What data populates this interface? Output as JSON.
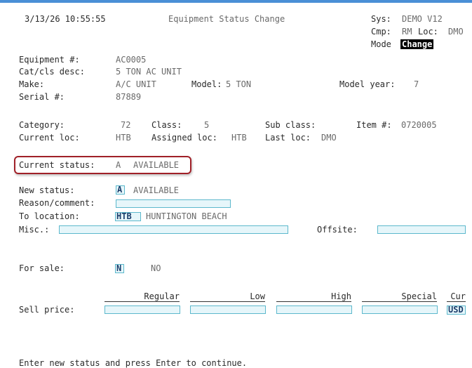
{
  "header": {
    "datetime": "3/13/26 10:55:55",
    "title": "Equipment Status Change",
    "sys_label": "Sys:",
    "sys_value": "DEMO V12",
    "cmp_label": "Cmp:",
    "cmp_value": "RM",
    "loc_label": "Loc:",
    "loc_value": "DMO",
    "mode_label": "Mode",
    "mode_value": "Change"
  },
  "equipment": {
    "equipment_label": "Equipment #:",
    "equipment_value": "AC0005",
    "catcls_label": "Cat/cls desc:",
    "catcls_value": "5 TON AC UNIT",
    "make_label": "Make:",
    "make_value": "A/C UNIT",
    "model_label": "Model:",
    "model_value": "5 TON",
    "model_year_label": "Model year:",
    "model_year_value": "7",
    "serial_label": "Serial #:",
    "serial_value": "87889"
  },
  "classification": {
    "category_label": "Category:",
    "category_value": "72",
    "class_label": "Class:",
    "class_value": "5",
    "subclass_label": "Sub class:",
    "item_label": "Item #:",
    "item_value": "0720005",
    "current_loc_label": "Current loc:",
    "current_loc_value": "HTB",
    "assigned_loc_label": "Assigned loc:",
    "assigned_loc_value": "HTB",
    "last_loc_label": "Last loc:",
    "last_loc_value": "DMO"
  },
  "current_status": {
    "label": "Current status:",
    "code": "A",
    "desc": "AVAILABLE"
  },
  "form": {
    "new_status_label": "New status:",
    "new_status_value": "A",
    "new_status_desc": "AVAILABLE",
    "reason_label": "Reason/comment:",
    "reason_value": "",
    "to_location_label": "To location:",
    "to_location_value": "HTB",
    "to_location_desc": "HUNTINGTON BEACH",
    "misc_label": "Misc.:",
    "misc_value": "",
    "offsite_label": "Offsite:",
    "offsite_value": "",
    "for_sale_label": "For sale:",
    "for_sale_value": "N",
    "for_sale_desc": "NO"
  },
  "pricing": {
    "headers": [
      "Regular",
      "Low",
      "High",
      "Special",
      "Cur"
    ],
    "sell_price_label": "Sell price:",
    "currency_value": "USD"
  },
  "footer": {
    "message": "Enter new status and press Enter to continue."
  },
  "colors": {
    "accent_bar": "#4a8fd6",
    "field_border": "#5cb8cc",
    "highlight_border": "#a02028"
  }
}
